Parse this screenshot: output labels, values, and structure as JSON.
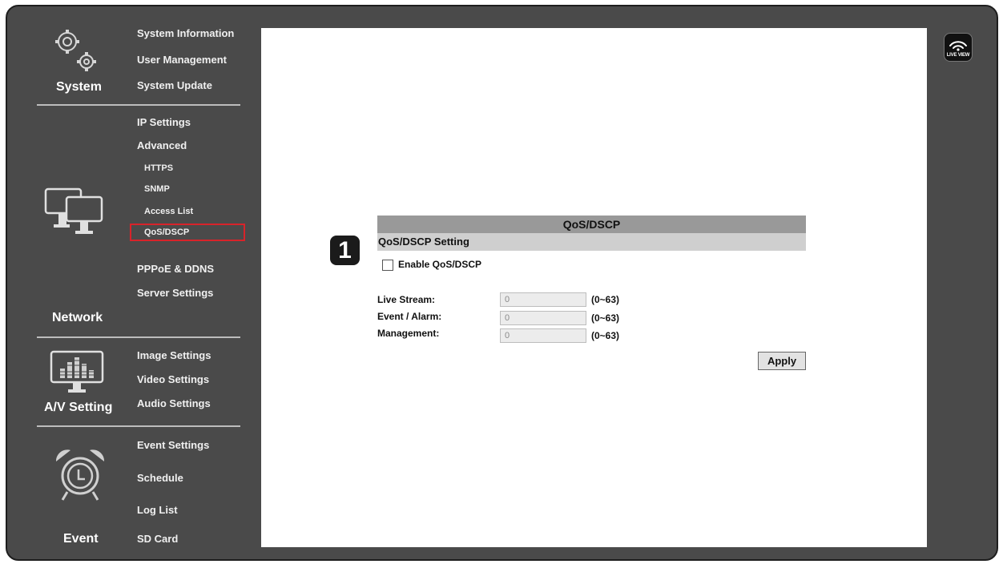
{
  "sidebar": {
    "system": {
      "label": "System",
      "items": [
        "System Information",
        "User Management",
        "System Update"
      ]
    },
    "network": {
      "label": "Network",
      "items": [
        "IP Settings",
        "Advanced",
        "HTTPS",
        "SNMP",
        "Access List",
        "QoS/DSCP",
        "PPPoE & DDNS",
        "Server Settings"
      ]
    },
    "av": {
      "label": "A/V Setting",
      "items": [
        "Image Settings",
        "Video Settings",
        "Audio Settings"
      ]
    },
    "event": {
      "label": "Event",
      "items": [
        "Event Settings",
        "Schedule",
        "Log List",
        "SD Card"
      ]
    }
  },
  "liveview": {
    "label": "LIVE VIEW",
    "icon": "live-view-icon"
  },
  "panel": {
    "title": "QoS/DSCP",
    "subtitle": "QoS/DSCP Setting",
    "badge": "1",
    "enable_label": "Enable QoS/DSCP",
    "enable_checked": false,
    "rows": [
      {
        "label": "Live Stream:",
        "value": "0",
        "range": "(0~63)"
      },
      {
        "label": "Event / Alarm:",
        "value": "0",
        "range": "(0~63)"
      },
      {
        "label": "Management:",
        "value": "0",
        "range": "(0~63)"
      }
    ],
    "apply_label": "Apply"
  },
  "colors": {
    "frame": "#4a4a4a",
    "highlight": "#d8232a",
    "title_bar": "#999999",
    "subtitle_bar": "#cfcfcf"
  }
}
